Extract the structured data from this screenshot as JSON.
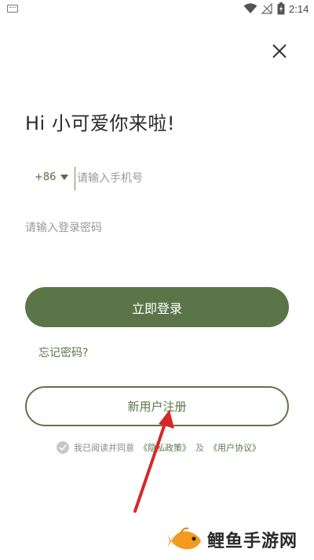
{
  "status_bar": {
    "time": "2:14",
    "icons": [
      "keyboard-icon",
      "wifi-icon",
      "no-signal-icon",
      "battery-icon"
    ]
  },
  "header": {
    "close_icon": "close-icon"
  },
  "greeting": "Hi 小可爱你来啦!",
  "phone": {
    "country_code": "+86",
    "placeholder": "请输入手机号",
    "value": ""
  },
  "password": {
    "placeholder": "请输入登录密码",
    "value": ""
  },
  "login_button": "立即登录",
  "forgot_password": "忘记密码?",
  "register_button": "新用户注册",
  "agreement": {
    "checked": true,
    "prefix": "我已阅读并同意",
    "privacy_link": "《隐私政策》",
    "joiner": "及",
    "terms_link": "《用户协议》"
  },
  "annotation": {
    "arrow_color": "#d62828"
  },
  "watermark": {
    "text": "鲤鱼手游网"
  },
  "colors": {
    "accent": "#5b7549",
    "muted_text": "#999999"
  }
}
